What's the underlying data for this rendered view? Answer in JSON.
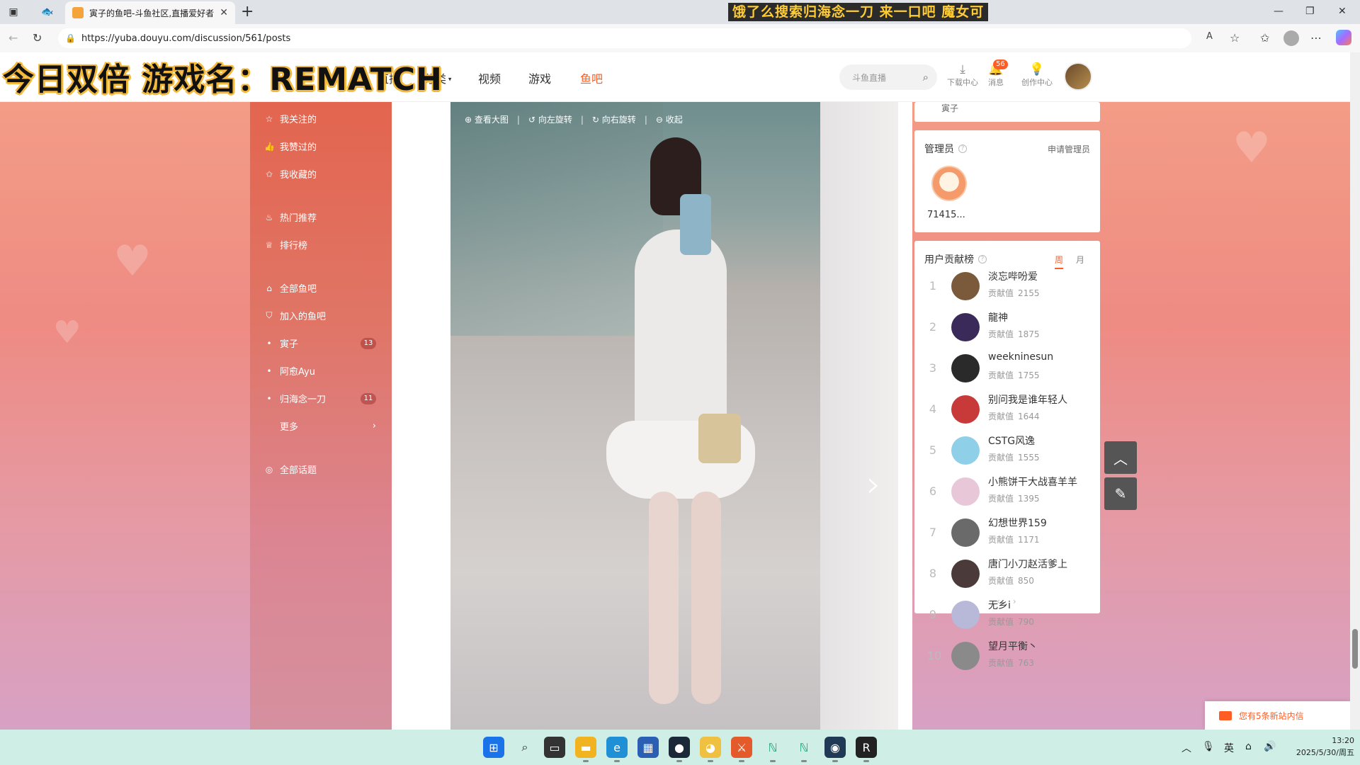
{
  "browser": {
    "tab_title": "寅子的鱼吧-斗鱼社区,直播爱好者",
    "url": "https://yuba.douyu.com/discussion/561/posts",
    "overlay_banner": "饿了么搜索归海念一刀 来一口吧 魔女可"
  },
  "stream_overlay": "今日双倍 游戏名：REMATCH",
  "header": {
    "nav": [
      "直播",
      "分类",
      "视频",
      "游戏",
      "鱼吧"
    ],
    "search_placeholder": "斗鱼直播",
    "tools": [
      {
        "label": "下载中心",
        "icon": "download-icon"
      },
      {
        "label": "消息",
        "icon": "bell-icon"
      },
      {
        "label": "创作中心",
        "icon": "bulb-icon"
      }
    ],
    "message_badge": "56"
  },
  "sidebar": {
    "items": [
      {
        "label": "我关注的",
        "icon": "star-icon"
      },
      {
        "label": "我赞过的",
        "icon": "thumb-icon"
      },
      {
        "label": "我收藏的",
        "icon": "favorite-icon"
      },
      {
        "label": "热门推荐",
        "icon": "fire-icon"
      },
      {
        "label": "排行榜",
        "icon": "trophy-icon"
      },
      {
        "label": "全部鱼吧",
        "icon": "home-icon"
      },
      {
        "label": "加入的鱼吧",
        "icon": "shield-icon"
      }
    ],
    "joined": [
      {
        "label": "寅子",
        "count": "13"
      },
      {
        "label": "阿愈Ayu",
        "count": ""
      },
      {
        "label": "归海念一刀",
        "count": "11"
      }
    ],
    "more": "更多",
    "topics": "全部话题"
  },
  "image_viewer": {
    "actions": [
      "查看大图",
      "向左旋转",
      "向右旋转",
      "收起"
    ]
  },
  "right": {
    "top_card_text": "寅子",
    "admin": {
      "title": "管理员",
      "apply": "申请管理员",
      "name": "71415..."
    },
    "rank": {
      "title": "用户贡献榜",
      "tabs": [
        "周",
        "月"
      ],
      "value_label": "贡献值",
      "rows": [
        {
          "rank": "1",
          "name": "淡忘哔吩爱",
          "value": "2155",
          "color": "#7a5a3a"
        },
        {
          "rank": "2",
          "name": "龍神",
          "value": "1875",
          "color": "#3a2a5a"
        },
        {
          "rank": "3",
          "name": "weekninesun",
          "value": "1755",
          "color": "#2a2a2a"
        },
        {
          "rank": "4",
          "name": "别问我是谁年轻人",
          "value": "1644",
          "color": "#c83a3a"
        },
        {
          "rank": "5",
          "name": "CSTG风逸",
          "value": "1555",
          "color": "#8fd0e8"
        },
        {
          "rank": "6",
          "name": "小熊饼干大战喜羊羊",
          "value": "1395",
          "color": "#e8c8d8"
        },
        {
          "rank": "7",
          "name": "幻想世界159",
          "value": "1171",
          "color": "#6a6a6a"
        },
        {
          "rank": "8",
          "name": "唐门小刀赵活爹上",
          "value": "850",
          "color": "#4a3a3a"
        },
        {
          "rank": "9",
          "name": "无乡i",
          "value": "790",
          "color": "#b8b8d8"
        },
        {
          "rank": "10",
          "name": "望月平衡丶",
          "value": "763",
          "color": "#8a8a8a"
        }
      ]
    }
  },
  "toast": "您有5条新站内信",
  "taskbar": {
    "ime": "英",
    "time": "13:20",
    "date": "2025/5/30/周五"
  },
  "colors": {
    "accent": "#ff5d23"
  }
}
